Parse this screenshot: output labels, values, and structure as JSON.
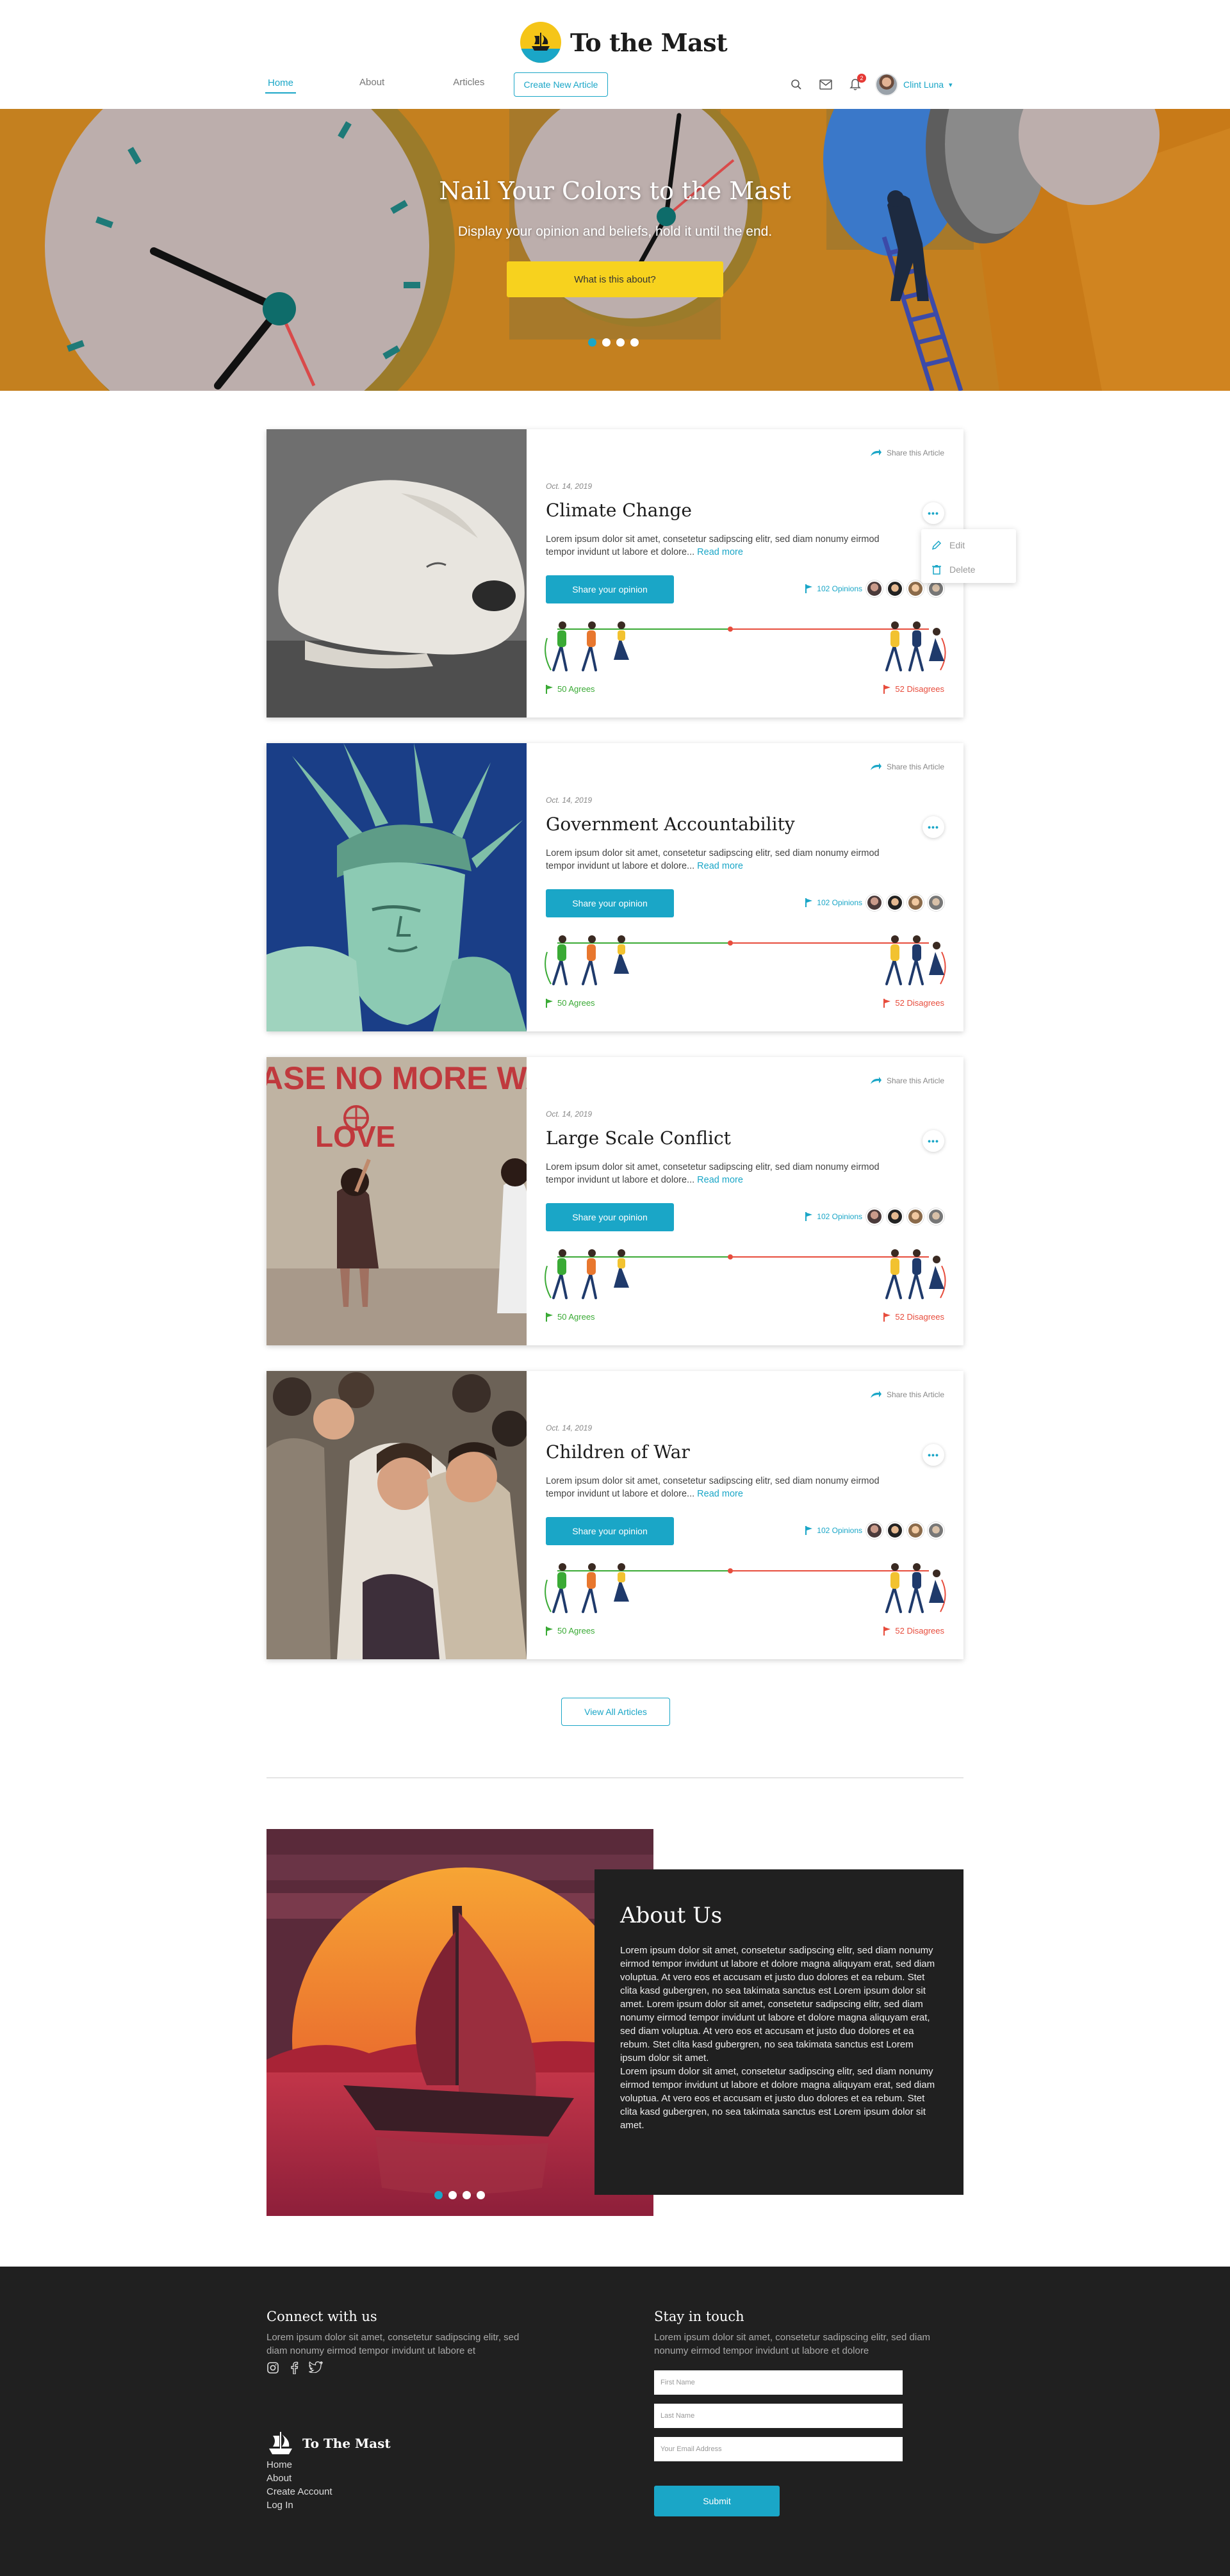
{
  "brand": {
    "name": "To the Mast"
  },
  "nav": {
    "home": "Home",
    "about": "About",
    "articles": "Articles",
    "create": "Create New Article"
  },
  "header": {
    "notifications": "2",
    "user_name": "Clint Luna",
    "caret": "▾"
  },
  "hero": {
    "title": "Nail Your Colors to the Mast",
    "subtitle": "Display your opinion and beliefs, hold it until the end.",
    "button": "What is this about?",
    "slides": 4,
    "active_slide": 1
  },
  "card_common": {
    "share": "Share this Article",
    "date": "Oct. 14, 2019",
    "text": "Lorem ipsum dolor sit amet, consetetur sadipscing elitr, sed diam nonumy eirmod tempor invidunt ut labore et dolore...",
    "read_more": "Read more",
    "button": "Share your opinion",
    "opinions": "102 Opinions",
    "agrees": "50 Agrees",
    "disagrees": "52 Disagrees",
    "more": "•••"
  },
  "articles": [
    {
      "title": "Climate Change"
    },
    {
      "title": "Government Accountability"
    },
    {
      "title": "Large Scale Conflict"
    },
    {
      "title": "Children of War"
    }
  ],
  "dropdown": {
    "edit": "Edit",
    "delete": "Delete"
  },
  "view_all": "View All Articles",
  "about": {
    "title": "About Us",
    "text": "Lorem ipsum dolor sit amet, consetetur sadipscing elitr, sed diam nonumy eirmod tempor invidunt ut labore et dolore magna aliquyam erat, sed diam voluptua. At vero eos et accusam et justo duo dolores et ea rebum. Stet clita kasd gubergren, no sea takimata sanctus est Lorem ipsum dolor sit amet. Lorem ipsum dolor sit amet, consetetur sadipscing elitr, sed diam nonumy eirmod tempor invidunt ut labore et dolore magna aliquyam erat, sed diam voluptua. At vero eos et accusam et justo duo dolores et ea rebum. Stet clita kasd gubergren, no sea takimata sanctus est Lorem ipsum dolor sit amet.",
    "text2": "Lorem ipsum dolor sit amet, consetetur sadipscing elitr, sed diam nonumy eirmod tempor invidunt ut labore et dolore magna aliquyam erat, sed diam voluptua. At vero eos et accusam et justo duo dolores et ea rebum. Stet clita kasd gubergren, no sea takimata sanctus est Lorem ipsum dolor sit amet.",
    "slides": 4,
    "active_slide": 1
  },
  "footer": {
    "connect_title": "Connect with us",
    "connect_text": "Lorem ipsum dolor sit amet, consetetur sadipscing elitr, sed diam nonumy eirmod tempor invidunt ut labore et",
    "logo_text": "To The Mast",
    "links": [
      "Home",
      "About",
      "Create Account",
      "Log In"
    ],
    "stay_title": "Stay in touch",
    "stay_text": "Lorem ipsum dolor sit amet, consetetur sadipscing elitr, sed diam nonumy eirmod tempor invidunt ut labore et dolore",
    "first_name_placeholder": "First Name",
    "last_name_placeholder": "Last Name",
    "email_placeholder": "Your Email Address",
    "submit": "Submit"
  },
  "colors": {
    "accent": "#1aa6c7",
    "hero_button": "#f7d21e",
    "agree": "#3aaa35",
    "disagree": "#e74c3c",
    "dark": "#202020"
  }
}
